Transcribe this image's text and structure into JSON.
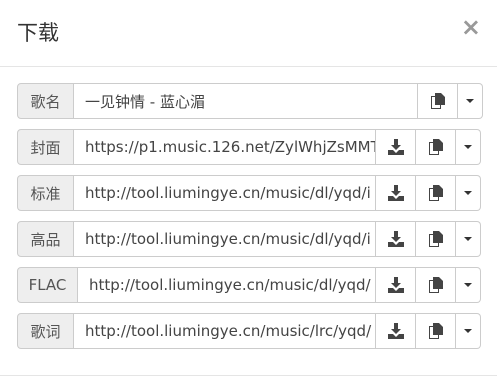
{
  "dialog": {
    "title": "下载",
    "close_label": "×"
  },
  "rows": [
    {
      "label": "歌名",
      "value": "一见钟情 - 蓝心湄",
      "has_download": false
    },
    {
      "label": "封面",
      "value": "https://p1.music.126.net/ZylWhjZsMMT",
      "has_download": true
    },
    {
      "label": "标准",
      "value": "http://tool.liumingye.cn/music/dl/yqd/i",
      "has_download": true
    },
    {
      "label": "高品",
      "value": "http://tool.liumingye.cn/music/dl/yqd/i",
      "has_download": true
    },
    {
      "label": "FLAC",
      "value": "http://tool.liumingye.cn/music/dl/yqd/",
      "has_download": true
    },
    {
      "label": "歌词",
      "value": "http://tool.liumingye.cn/music/lrc/yqd/",
      "has_download": true
    }
  ],
  "icons": {
    "download": "download-icon",
    "copy": "copy-icon",
    "dropdown": "caret-down-icon",
    "close": "close-icon"
  },
  "colors": {
    "addon_bg": "#eeeeee",
    "border": "#cccccc",
    "icon": "#444444"
  }
}
